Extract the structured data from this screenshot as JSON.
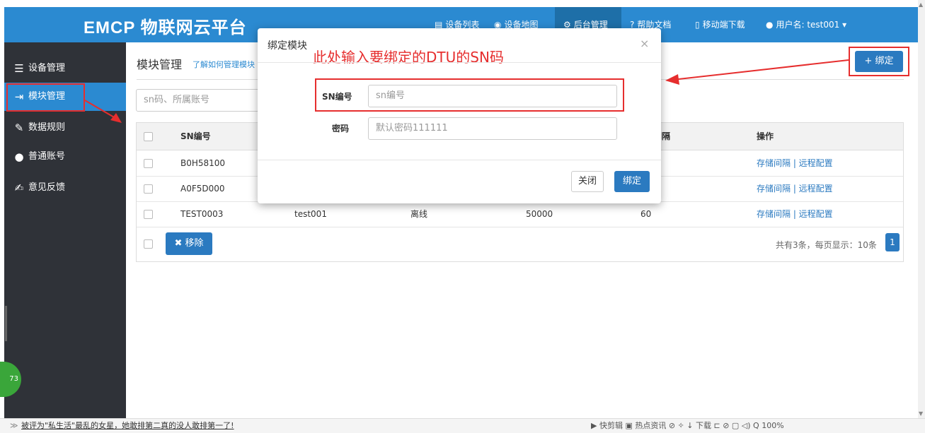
{
  "app": {
    "logo": "EMCP 物联网云平台"
  },
  "nav": [
    {
      "icon": "▤",
      "label": "设备列表"
    },
    {
      "icon": "◉",
      "label": "设备地图"
    },
    {
      "icon": "⚙",
      "label": "后台管理"
    },
    {
      "icon": "?",
      "label": "帮助文档"
    },
    {
      "icon": "▯",
      "label": "移动端下载"
    },
    {
      "icon": "●",
      "label": "用户名: test001 ▾"
    }
  ],
  "sidebar": {
    "items": [
      {
        "icon": "☰",
        "label": "设备管理"
      },
      {
        "icon": "⇥",
        "label": "模块管理"
      },
      {
        "icon": "✎",
        "label": "数据规则"
      },
      {
        "icon": "●",
        "label": "普通账号"
      },
      {
        "icon": "✍",
        "label": "意见反馈"
      }
    ]
  },
  "page": {
    "title": "模块管理",
    "help_link": "了解如何管理模块",
    "bind_button": "+ 绑定",
    "search_placeholder": "sn码、所属账号"
  },
  "table": {
    "headers": [
      "SN编号",
      "间隔",
      "操作"
    ],
    "rows": [
      {
        "sn": "B0H58100",
        "account": "",
        "status": "",
        "size": "",
        "interval": "",
        "ops": "存储间隔 | 远程配置"
      },
      {
        "sn": "A0F5D000",
        "account": "",
        "status": "",
        "size": "",
        "interval": "",
        "ops": "存储间隔 | 远程配置"
      },
      {
        "sn": "TEST0003",
        "account": "test001",
        "status": "离线",
        "size": "50000",
        "interval": "60",
        "ops": "存储间隔 | 远程配置"
      }
    ],
    "remove_button": "✖ 移除",
    "pager_text": "共有3条，每页显示：10条",
    "page_number": "1"
  },
  "modal": {
    "title": "绑定模块",
    "close_icon": "×",
    "annotation": "此处输入要绑定的DTU的SN码",
    "sn_label": "SN编号",
    "sn_placeholder": "sn编号",
    "password_label": "密码",
    "password_placeholder": "默认密码111111",
    "close_button": "关闭",
    "bind_button": "绑定"
  },
  "statusbar": {
    "left_text": "被评为\"私生活\"最乱的女星，她敢排第二真的没人敢排第一了!",
    "right_text": "▶ 快剪辑  ▣ 热点资讯   ⊘   ✧   ↓ 下载   ⊏   ⊘   ▢   ◁)   Q 100%"
  },
  "badge": {
    "value": "73"
  },
  "colors": {
    "primary": "#2b8ad1",
    "sidebar": "#2f3238",
    "annotation": "#e62e2e"
  }
}
